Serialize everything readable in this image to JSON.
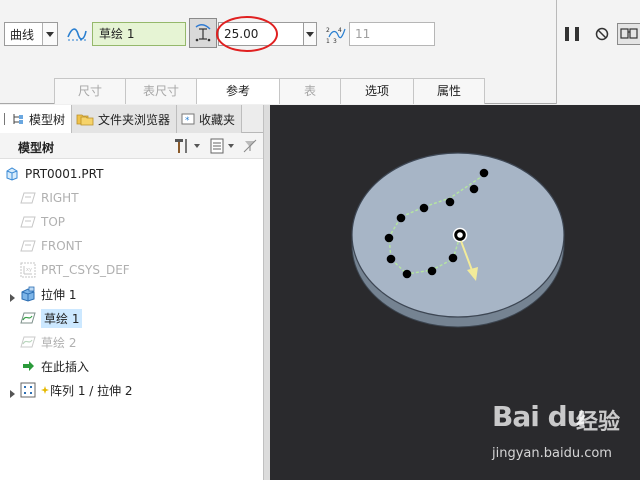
{
  "dashboard": {
    "curve_type": "曲线",
    "sketch_name": "草绘 1",
    "depth_value": "25.00",
    "count_value": "11",
    "tabs": [
      {
        "label": "尺寸",
        "state": "disabled"
      },
      {
        "label": "表尺寸",
        "state": "disabled"
      },
      {
        "label": "参考",
        "state": "active"
      },
      {
        "label": "表",
        "state": "disabled"
      },
      {
        "label": "选项",
        "state": "normal"
      },
      {
        "label": "属性",
        "state": "normal"
      }
    ]
  },
  "navigator": {
    "tabs": [
      "模型树",
      "文件夹浏览器",
      "收藏夹"
    ],
    "header_title": "模型树"
  },
  "tree": {
    "root": "PRT0001.PRT",
    "items": [
      {
        "label": "RIGHT",
        "state": "gray",
        "icon": "datum-plane-icon"
      },
      {
        "label": "TOP",
        "state": "gray",
        "icon": "datum-plane-icon"
      },
      {
        "label": "FRONT",
        "state": "gray",
        "icon": "datum-plane-icon"
      },
      {
        "label": "PRT_CSYS_DEF",
        "state": "gray",
        "icon": "csys-icon"
      },
      {
        "label": "拉伸 1",
        "state": "normal",
        "icon": "extrude-icon"
      },
      {
        "label": "草绘 1",
        "state": "selected",
        "icon": "sketch-icon"
      },
      {
        "label": "草绘 2",
        "state": "gray",
        "icon": "sketch-icon"
      },
      {
        "label": "在此插入",
        "state": "normal",
        "icon": "insert-arrow-icon"
      },
      {
        "label": "阵列 1 / 拉伸 2",
        "state": "normal",
        "icon": "pattern-icon"
      }
    ]
  },
  "watermark": {
    "logo": "Bai du",
    "brand": "经验",
    "url": "jingyan.baidu.com"
  },
  "colors": {
    "accent_red": "#e02020",
    "sketch_green": "#e6f4d4",
    "selection": "#cce8ff",
    "viewport_bg": "#2a2a2d",
    "disc": "#a7b5c6"
  }
}
